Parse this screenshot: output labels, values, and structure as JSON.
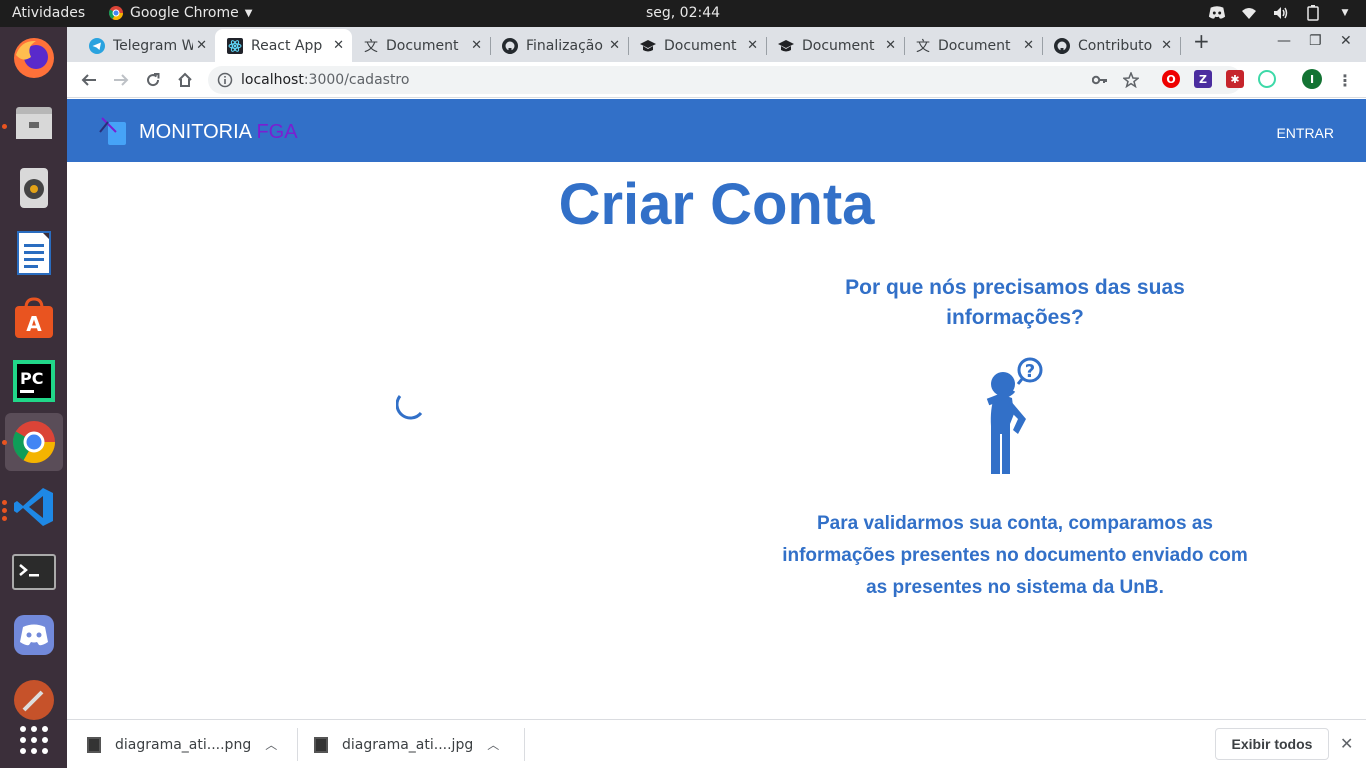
{
  "topbar": {
    "activities": "Atividades",
    "app_name": "Google Chrome",
    "clock": "seg, 02:44"
  },
  "dock": {
    "apps": [
      "firefox-icon",
      "files-icon",
      "rhythmbox-icon",
      "writer-icon",
      "software-center-icon",
      "pycharm-icon",
      "chrome-icon",
      "vscode-icon",
      "terminal-icon",
      "discord-icon",
      "tool-icon",
      "show-apps-icon"
    ]
  },
  "tabs": [
    {
      "title": "Telegram W",
      "icon": "telegram-icon"
    },
    {
      "title": "React App",
      "icon": "react-icon",
      "active": true
    },
    {
      "title": "Document",
      "icon": "translate-icon"
    },
    {
      "title": "Finalização",
      "icon": "github-icon"
    },
    {
      "title": "Document",
      "icon": "graduation-cap-icon"
    },
    {
      "title": "Document",
      "icon": "graduation-cap-icon"
    },
    {
      "title": "Document",
      "icon": "translate-icon"
    },
    {
      "title": "Contributo",
      "icon": "github-icon"
    }
  ],
  "omnibox": {
    "host": "localhost",
    "path": ":3000/cadastro"
  },
  "profile_initial": "I",
  "navbar": {
    "brand_main": "MONITORIA",
    "brand_accent": "FGA",
    "login_link": "ENTRAR"
  },
  "page": {
    "title": "Criar Conta",
    "why_heading": "Por que nós precisamos das suas informações?",
    "explanation": "Para validarmos sua conta, comparamos as informações presentes no documento enviado com as presentes no sistema da UnB."
  },
  "downloads": {
    "items": [
      {
        "name": "diagrama_ati....png"
      },
      {
        "name": "diagrama_ati....jpg"
      }
    ],
    "show_all": "Exibir todos"
  },
  "colors": {
    "brand_blue": "#3270c8",
    "brand_purple": "#7a1fd1"
  }
}
